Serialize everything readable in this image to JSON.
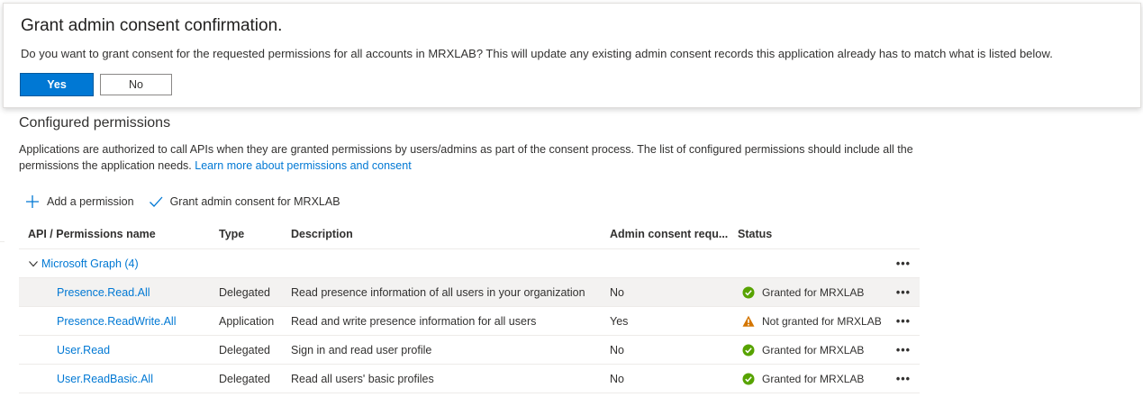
{
  "dialog": {
    "title": "Grant admin consent confirmation.",
    "message": "Do you want to grant consent for the requested permissions for all accounts in MRXLAB? This will update any existing admin consent records this application already has to match what is listed below.",
    "yes_label": "Yes",
    "no_label": "No"
  },
  "section": {
    "title": "Configured permissions",
    "description": "Applications are authorized to call APIs when they are granted permissions by users/admins as part of the consent process. The list of configured permissions should include all the permissions the application needs.",
    "link_text": "Learn more about permissions and consent"
  },
  "toolbar": {
    "add_permission": "Add a permission",
    "grant_consent": "Grant admin consent for MRXLAB"
  },
  "table": {
    "headers": {
      "name": "API / Permissions name",
      "type": "Type",
      "description": "Description",
      "admin": "Admin consent requ...",
      "status": "Status"
    },
    "group": {
      "label": "Microsoft Graph (4)",
      "more": "•••"
    },
    "rows": [
      {
        "name": "Presence.Read.All",
        "type": "Delegated",
        "description": "Read presence information of all users in your organization",
        "admin": "No",
        "status": "Granted for MRXLAB",
        "status_kind": "granted",
        "more": "•••"
      },
      {
        "name": "Presence.ReadWrite.All",
        "type": "Application",
        "description": "Read and write presence information for all users",
        "admin": "Yes",
        "status": "Not granted for MRXLAB",
        "status_kind": "warning",
        "more": "•••"
      },
      {
        "name": "User.Read",
        "type": "Delegated",
        "description": "Sign in and read user profile",
        "admin": "No",
        "status": "Granted for MRXLAB",
        "status_kind": "granted",
        "more": "•••"
      },
      {
        "name": "User.ReadBasic.All",
        "type": "Delegated",
        "description": "Read all users' basic profiles",
        "admin": "No",
        "status": "Granted for MRXLAB",
        "status_kind": "granted",
        "more": "•••"
      }
    ]
  },
  "colors": {
    "accent": "#0078d4",
    "granted": "#57a300",
    "warning": "#d47500"
  }
}
